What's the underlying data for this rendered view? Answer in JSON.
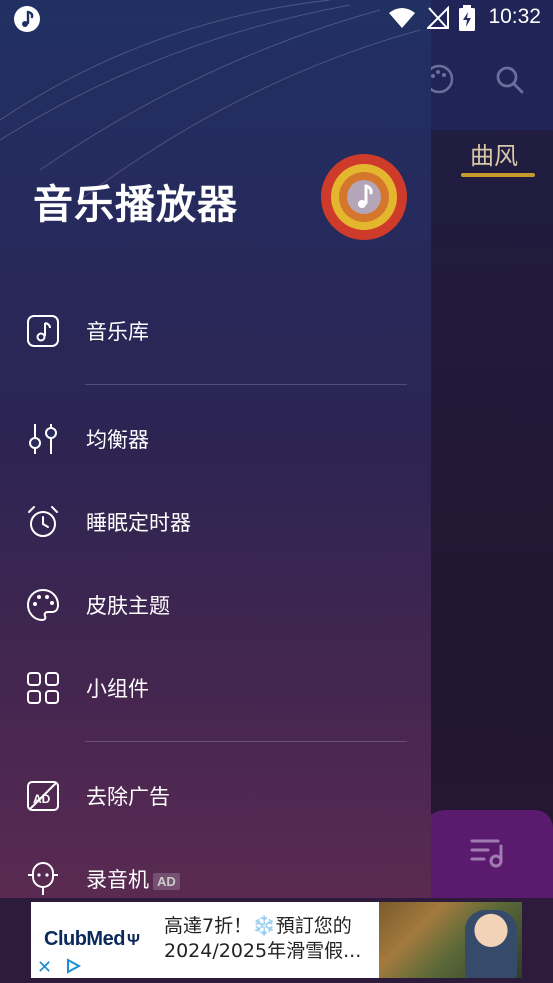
{
  "status_bar": {
    "time": "10:32",
    "icons": [
      "music-note-icon",
      "wifi-icon",
      "no-signal-icon",
      "battery-charging-icon"
    ]
  },
  "background_app": {
    "tab_label": "曲风",
    "accent_color": "#c89a2d",
    "icons": [
      "palette-icon",
      "search-icon",
      "queue-music-icon"
    ]
  },
  "drawer": {
    "title": "音乐播放器",
    "logo_icon": "music-disc-icon",
    "items": [
      {
        "label": "音乐库",
        "icon": "music-library-icon"
      },
      {
        "label": "均衡器",
        "icon": "equalizer-icon"
      },
      {
        "label": "睡眠定时器",
        "icon": "alarm-clock-icon"
      },
      {
        "label": "皮肤主题",
        "icon": "palette-icon"
      },
      {
        "label": "小组件",
        "icon": "widgets-grid-icon"
      },
      {
        "label": "去除广告",
        "icon": "remove-ads-icon"
      },
      {
        "label": "录音机",
        "icon": "microphone-icon",
        "badge": "AD"
      }
    ]
  },
  "ad": {
    "brand": "ClubMed",
    "text": "高達7折！❄️預訂您的2024/2025年滑雪假...",
    "close_label": "✕"
  }
}
